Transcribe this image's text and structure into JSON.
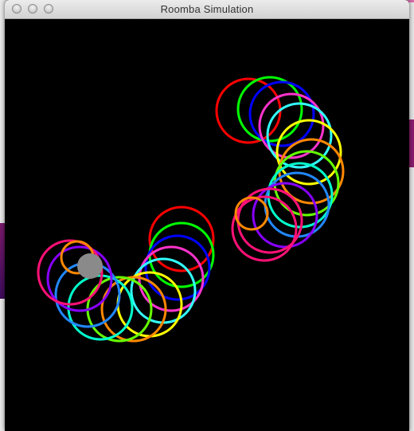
{
  "window": {
    "title": "Roomba Simulation"
  },
  "colors": {
    "background": "#000000",
    "titlebar": "#dcdcdc",
    "robot_body": "#8a8a8a"
  },
  "window_controls": [
    "close-icon",
    "minimize-icon",
    "zoom-icon"
  ]
}
